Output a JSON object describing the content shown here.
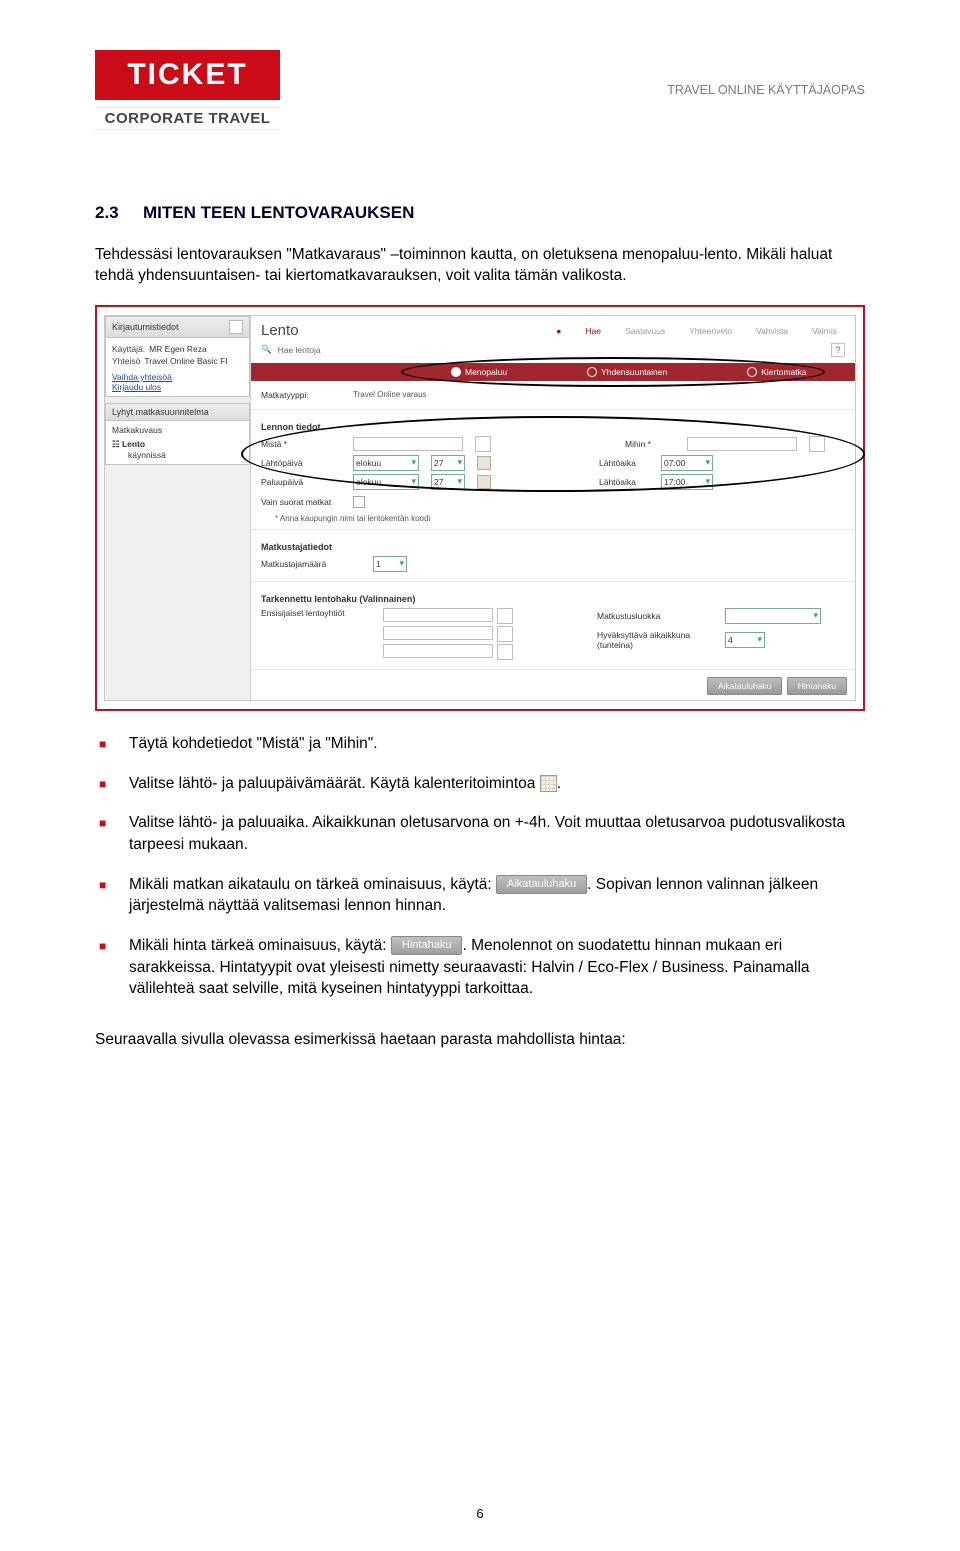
{
  "header": {
    "logo_main": "TICKET",
    "logo_sub": "CORPORATE TRAVEL",
    "right": "TRAVEL ONLINE KÄYTTÄJÄOPAS"
  },
  "section": {
    "number": "2.3",
    "title": "MITEN TEEN LENTOVARAUKSEN"
  },
  "intro": "Tehdessäsi lentovarauksen \"Matkavaraus\" –toiminnon kautta, on oletuksena menopaluu-lento. Mikäli haluat tehdä yhdensuuntaisen- tai kiertomatkavarauksen, voit valita tämän valikosta.",
  "screenshot": {
    "left_panel_1_title": "Kirjautumistiedot",
    "left_p1_user_label": "Käyttäjä:",
    "left_p1_user_value": "MR Egen Reza",
    "left_p1_company_label": "Yhteisö",
    "left_p1_company_value": "Travel Online Basic FI",
    "left_p1_link1": "Vaihda yhteisöä",
    "left_p1_link2": "Kirjaudu ulos",
    "left_panel_2_title": "Lyhyt matkasuunnitelma",
    "left_p2_row1": "Matkakuvaus",
    "left_p2_row2": "Lento",
    "left_p2_row3": "käynnissä",
    "main_title": "Lento",
    "step1": "Hae",
    "step2": "Saatavuus",
    "step3": "Yhteenveto",
    "step4": "Vahvista",
    "step5": "Valmis",
    "sub_search": "Hae lentoja",
    "radio1": "Menopaluu",
    "radio2": "Yhdensuuntainen",
    "radio3": "Kiertomatka",
    "sec_mt_type_label": "Matkatyyppi:",
    "sec_mt_type_value": "Travel Online varaus",
    "sec2_head": "Lennon tiedot",
    "from_label": "Mistä *",
    "to_label": "Mihin *",
    "dep_date_label": "Lähtöpäivä",
    "ret_date_label": "Paluupäivä",
    "month": "elokuu",
    "day": "27",
    "dep_time_label": "Lähtöaika",
    "dep_time": "07:00",
    "ret_time_label": "Lähtöaika",
    "ret_time": "17:00",
    "direct_label": "Vain suorat matkat",
    "note": "* Anna kaupungin nimi tai lentokentän koodi",
    "sec3_head": "Matkustajatiedot",
    "pax_label": "Matkustajamäärä",
    "pax_val": "1",
    "sec4_head": "Tarkennettu lentohaku (Valinnainen)",
    "pref_air_label": "Ensisijaiset lentoyhtiöt",
    "class_label": "Matkustusluokka",
    "window_label": "Hyväksyttävä aikaikkuna\n(tunteina)",
    "window_val": "4",
    "btn1": "Aikatauluhaku",
    "btn2": "Hintahaku"
  },
  "bullets": {
    "b1": "Täytä kohdetiedot \"Mistä\" ja \"Mihin\".",
    "b2_a": "Valitse lähtö- ja paluupäivämäärät. Käytä kalenteritoimintoa ",
    "b2_b": ".",
    "b3": "Valitse lähtö- ja paluuaika. Aikaikkunan oletusarvona on +-4h. Voit muuttaa oletusarvoa pudotusvalikosta tarpeesi mukaan.",
    "b4_a": "Mikäli matkan aikataulu on tärkeä ominaisuus, käytä: ",
    "b4_b": ". Sopivan lennon valinnan jälkeen järjestelmä näyttää valitsemasi lennon hinnan.",
    "b5_a": "Mikäli hinta tärkeä ominaisuus, käytä: ",
    "b5_b": ". Menolennot on suodatettu hinnan mukaan eri sarakkeissa. Hintatyypit ovat yleisesti nimetty seuraavasti: Halvin / Eco-Flex / Business. Painamalla välilehteä saat selville, mitä kyseinen hintatyyppi tarkoittaa."
  },
  "inline_buttons": {
    "aik": "Aikatauluhaku",
    "hinta": "Hintahaku"
  },
  "closing": "Seuraavalla sivulla olevassa esimerkissä haetaan parasta mahdollista hintaa:",
  "page_number": "6"
}
